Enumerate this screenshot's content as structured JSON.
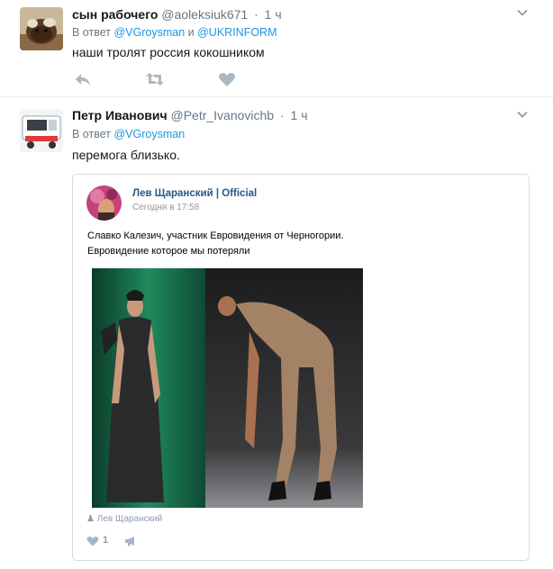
{
  "tweets": [
    {
      "name": "сын рабочего",
      "handle": "@aoleksiuk671",
      "dot": "·",
      "time": "1 ч",
      "reply_prefix": "В ответ",
      "reply_mention1": "@VGroysman",
      "reply_joiner": "и",
      "reply_mention2": "@UKRINFORM",
      "text": "наши тролят россия кокошником"
    },
    {
      "name": "Петр Иванович",
      "handle": "@Petr_Ivanovichb",
      "dot": "·",
      "time": "1 ч",
      "reply_prefix": "В ответ",
      "reply_mention1": "@VGroysman",
      "text": "перемога близько.",
      "card": {
        "author": "Лев Щаранский | Official",
        "timestamp": "Сегодня в 17:58",
        "line1": "Славко Калезич, участник Евровидения от Черногории.",
        "line2": "Евровидение которое мы потеряли",
        "footer_author": "Лев Щаранский",
        "like_count": "1"
      }
    }
  ],
  "icons": {
    "reply": "reply-icon",
    "retweet": "retweet-icon",
    "like": "heart-icon",
    "menu": "chevron-down-icon"
  },
  "colors": {
    "link": "#1b95e0",
    "secondary": "#657786",
    "action_icon": "#aab8c2",
    "vk_name": "#2a5885"
  }
}
